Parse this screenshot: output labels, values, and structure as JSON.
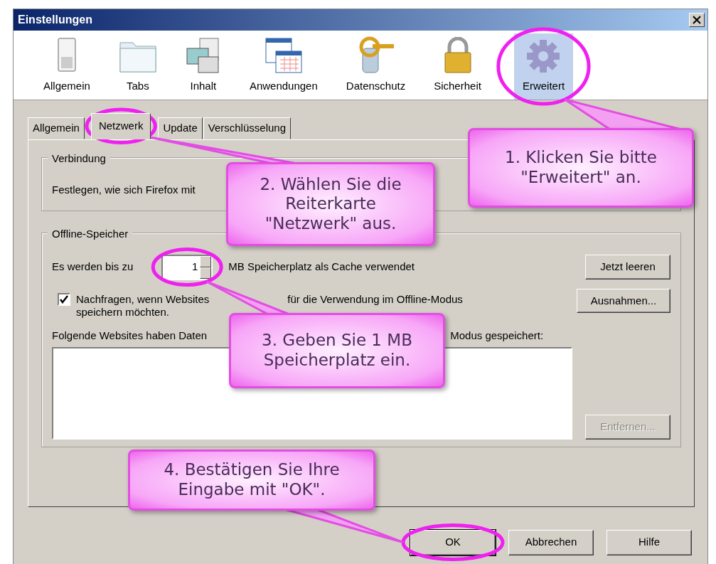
{
  "window": {
    "title": "Einstellungen"
  },
  "toolbar": [
    {
      "label": "Allgemein",
      "selected": false
    },
    {
      "label": "Tabs",
      "selected": false
    },
    {
      "label": "Inhalt",
      "selected": false
    },
    {
      "label": "Anwendungen",
      "selected": false
    },
    {
      "label": "Datenschutz",
      "selected": false
    },
    {
      "label": "Sicherheit",
      "selected": false
    },
    {
      "label": "Erweitert",
      "selected": true
    }
  ],
  "tabs": [
    {
      "label": "Allgemein",
      "selected": false
    },
    {
      "label": "Netzwerk",
      "selected": true
    },
    {
      "label": "Update",
      "selected": false
    },
    {
      "label": "Verschlüsselung",
      "selected": false
    }
  ],
  "connection": {
    "legend": "Verbindung",
    "text": "Festlegen, wie sich Firefox mit"
  },
  "offline": {
    "legend": "Offline-Speicher",
    "size_label": "Es werden bis zu",
    "size_value": "1",
    "size_suffix": "MB Speicherplatz als Cache verwendet",
    "clear_button": "Jetzt leeren",
    "ask": {
      "label_parts": [
        "Nachfragen, wenn Websites",
        "für die Verwendung im Offline-Modus",
        "speichern möchten."
      ],
      "checked": true
    },
    "exceptions_button": "Ausnahmen...",
    "list_label_parts": [
      "Folgende Websites haben Daten",
      "Modus gespeichert:"
    ],
    "remove_button": {
      "label": "Entfernen...",
      "disabled": true
    }
  },
  "buttons": [
    {
      "label": "OK",
      "kind": "default"
    },
    {
      "label": "Abbrechen",
      "kind": "normal"
    },
    {
      "label": "Hilfe",
      "kind": "normal"
    }
  ],
  "callouts": [
    {
      "lines": [
        "1. Klicken Sie bitte",
        "\"Erweitert\" an."
      ]
    },
    {
      "lines": [
        "2. Wählen Sie die",
        "Reiterkarte",
        "\"Netzwerk\" aus."
      ]
    },
    {
      "lines": [
        "3. Geben Sie 1 MB",
        "Speicherplatz ein."
      ]
    },
    {
      "lines": [
        "4. Bestätigen Sie Ihre",
        "Eingabe mit \"OK\"."
      ]
    }
  ]
}
